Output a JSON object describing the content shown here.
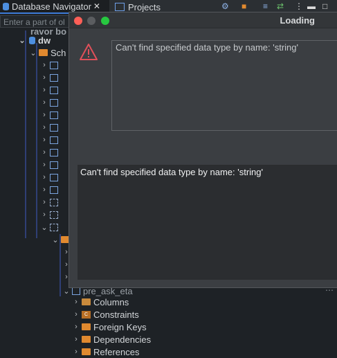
{
  "navigator": {
    "tab_active_label": "Database Navigator",
    "tab_close": "✕",
    "tab_projects_label": "Projects",
    "filter_placeholder": "Enter a part of ol",
    "tree": {
      "clipped_top": "ravor bo",
      "db_label": "dw",
      "schemas_label": "Sch",
      "table_label": "pre_ask_eta",
      "children": [
        "Columns",
        "Constraints",
        "Foreign Keys",
        "Dependencies",
        "References"
      ]
    }
  },
  "dialog": {
    "title": "Loading",
    "message": "Can't find specified data type by name: 'string'",
    "details": "Can't find specified data type by name: 'string'",
    "warning_color": "#e0505a"
  }
}
